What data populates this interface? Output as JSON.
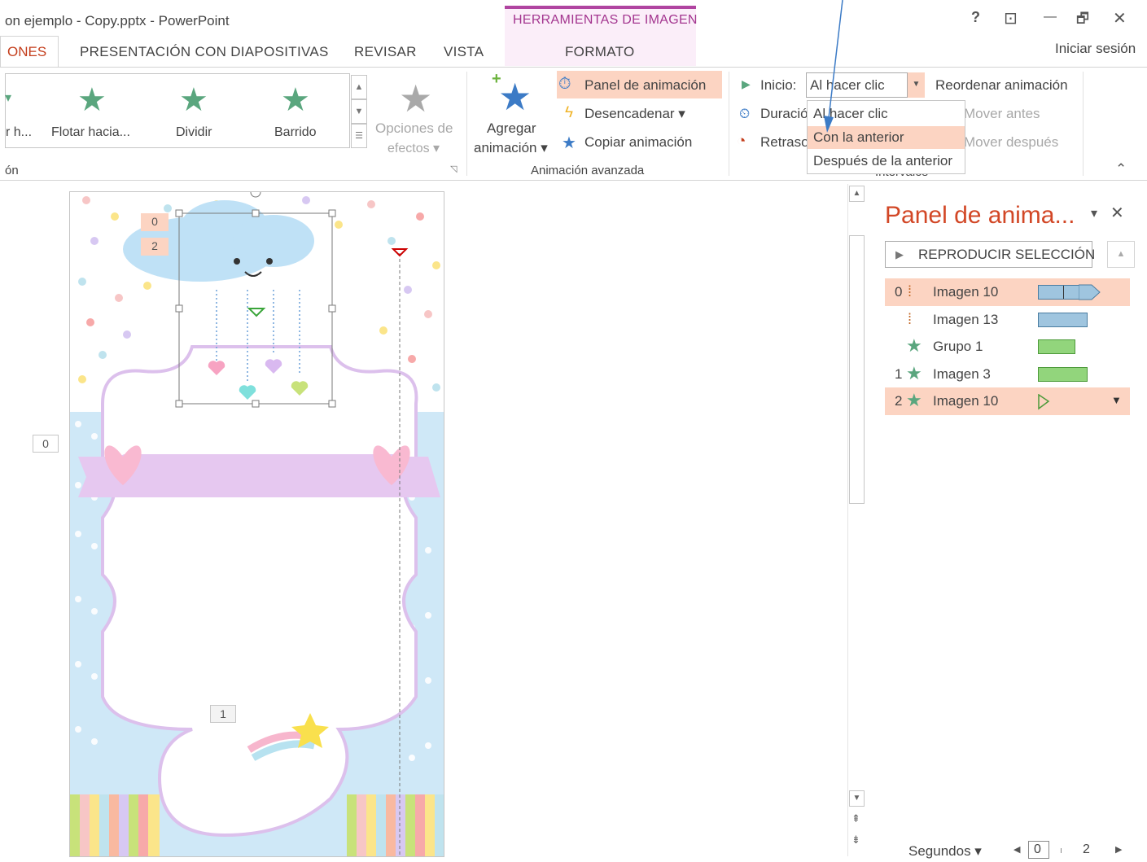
{
  "window": {
    "title": "on ejemplo - Copy.pptx - PowerPoint",
    "context_tab_label": "HERRAMIENTAS DE IMAGEN",
    "help": "?",
    "restore": "⊡",
    "minimize": "—",
    "maximize": "🗗",
    "close": "✕",
    "sign_in": "Iniciar sesión"
  },
  "tabs": {
    "animations": "ONES",
    "slideshow": "PRESENTACIÓN CON DIAPOSITIVAS",
    "review": "REVISAR",
    "view": "VISTA",
    "format": "FORMATO"
  },
  "ribbon": {
    "gallery": {
      "items": [
        "r h...",
        "Flotar hacia...",
        "Dividir",
        "Barrido"
      ],
      "group_label": "ón"
    },
    "effect_options": {
      "line1": "Opciones de",
      "line2": "efectos ▾"
    },
    "add_animation": {
      "line1": "Agregar",
      "line2": "animación ▾"
    },
    "animation_pane_btn": "Panel de animación",
    "trigger_btn": "Desencadenar ▾",
    "copy_animation_btn": "Copiar animación",
    "advanced_group_label": "Animación avanzada",
    "start_label": "Inicio:",
    "start_value": "Al hacer clic",
    "duration_label": "Duració",
    "delay_label": "Retraso",
    "reorder_label": "Reordenar animación",
    "move_earlier": "Mover antes",
    "move_later": "Mover después",
    "timing_group_label": "Intervalos",
    "collapse": "⌃"
  },
  "start_menu": {
    "options": [
      "Al hacer clic",
      "Con la anterior",
      "Después de la anterior"
    ],
    "highlighted_index": 1
  },
  "slide": {
    "badges": [
      "0",
      "2",
      "0",
      "1"
    ]
  },
  "animation_pane": {
    "title": "Panel de anima...",
    "dropdown": "▾",
    "close": "✕",
    "play_button": "REPRODUCIR SELECCIÓN",
    "items": [
      {
        "num": "0",
        "name": "Imagen 10",
        "icon": "path-icon",
        "bar": "blue-arrow",
        "selected": true
      },
      {
        "num": "",
        "name": "Imagen 13",
        "icon": "path-icon",
        "bar": "blue",
        "selected": false
      },
      {
        "num": "",
        "name": "Grupo 1",
        "icon": "star-icon",
        "bar": "green",
        "selected": false
      },
      {
        "num": "1",
        "name": "Imagen 3",
        "icon": "star-icon",
        "bar": "green",
        "selected": false
      },
      {
        "num": "2",
        "name": "Imagen 10",
        "icon": "star-icon",
        "bar": "play-marker",
        "selected": true
      }
    ],
    "seconds_label": "Segundos ▾",
    "timeline": [
      "0",
      "2"
    ]
  },
  "colors": {
    "accent": "#d24726",
    "highlight": "#fcd4c2",
    "context": "#a3358f"
  }
}
